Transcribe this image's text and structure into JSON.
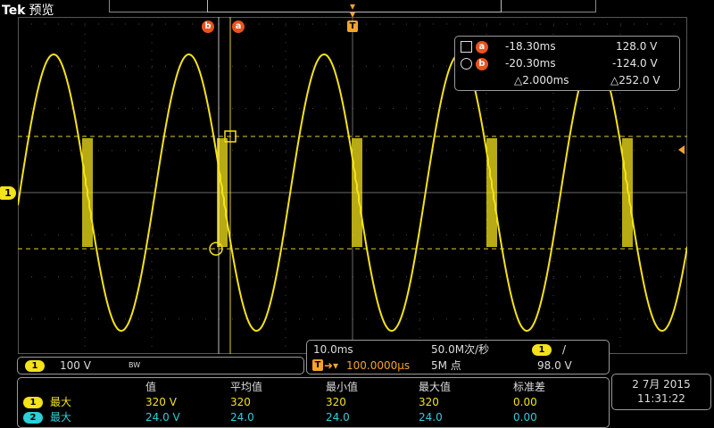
{
  "header": {
    "brand": "Tek",
    "mode": "预览"
  },
  "markers": {
    "cursor_b": "b",
    "cursor_a": "a",
    "trigger": "T",
    "ch1_ground": "1"
  },
  "cursor_readout": {
    "a": {
      "label": "a",
      "time": "-18.30ms",
      "voltage": "128.0 V"
    },
    "b": {
      "label": "b",
      "time": "-20.30ms",
      "voltage": "-124.0 V"
    },
    "delta": {
      "time": "△2.000ms",
      "voltage": "△252.0 V"
    }
  },
  "channel": {
    "num": "1",
    "scale": "100 V",
    "bw": "BW"
  },
  "horizontal": {
    "timebase": "10.0ms",
    "sample_rate": "50.0M次/秒",
    "trig_chan": "1",
    "trig_slope": "/",
    "trig_position": "100.0000μs",
    "record_length": "5M 点",
    "trig_level": "98.0 V"
  },
  "measurements": {
    "headers": [
      "值",
      "平均值",
      "最小值",
      "最大值",
      "标准差"
    ],
    "rows": [
      {
        "chan": "1",
        "label": "最大",
        "values": [
          "320 V",
          "320",
          "320",
          "320",
          "0.00"
        ]
      },
      {
        "chan": "2",
        "label": "最大",
        "values": [
          "24.0 V",
          "24.0",
          "24.0",
          "24.0",
          "0.00"
        ]
      }
    ]
  },
  "datetime": {
    "date": "2 7月 2015",
    "time": "11:31:22"
  },
  "colors": {
    "ch1": "#f4e21a",
    "ch2": "#2bd0d8",
    "cursor": "#e8541c",
    "trigger": "#f7a32b"
  }
}
